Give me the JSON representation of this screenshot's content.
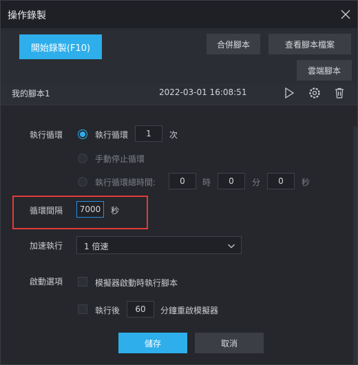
{
  "window": {
    "title": "操作錄製",
    "close_icon": "close-icon"
  },
  "toolbar": {
    "record_label": "開始錄製(F10)",
    "merge_label": "合併腳本",
    "view_label": "查看腳本檔案",
    "cloud_label": "雲端腳本"
  },
  "script": {
    "name": "我的腳本1",
    "datetime": "2022-03-01 16:08:51",
    "icons": [
      "play-icon",
      "settings-icon",
      "trash-icon"
    ]
  },
  "settings": {
    "loop_label": "執行循環",
    "loop_option1_label": "執行循環",
    "loop_count": "1",
    "loop_count_unit": "次",
    "loop_option2_label": "手動停止循環",
    "loop_option3_label": "執行循環總時間:",
    "total_h": "0",
    "unit_h": "時",
    "total_m": "0",
    "unit_m": "分",
    "total_s": "0",
    "unit_s": "秒",
    "interval_label": "循環間隔",
    "interval_value": "7000",
    "interval_unit": "秒",
    "speed_label": "加速執行",
    "speed_value": "1 倍速",
    "startup_label": "啟動選項",
    "startup_option1_label": "模擬器啟動時執行腳本",
    "startup_option2_prefix": "執行後",
    "restart_minutes": "60",
    "startup_option2_suffix": "分鐘重啟模擬器"
  },
  "footer": {
    "save_label": "儲存",
    "cancel_label": "取消"
  },
  "colors": {
    "accent": "#2eaeea",
    "highlight": "#e33b3b",
    "background": "#25272c"
  }
}
